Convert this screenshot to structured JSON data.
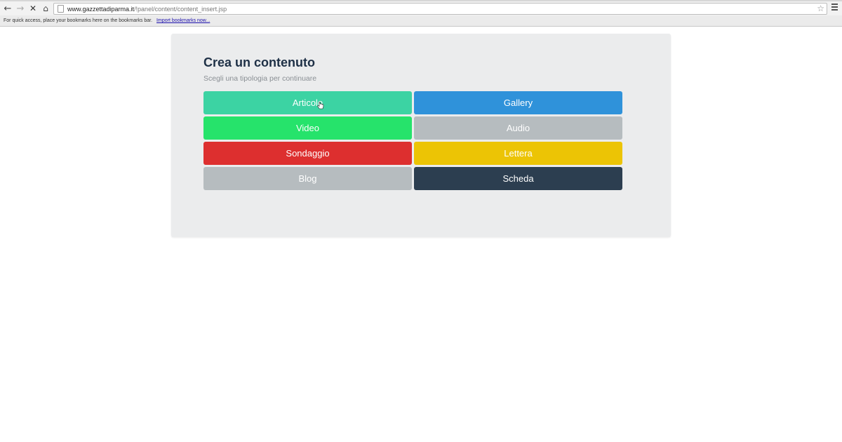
{
  "browser": {
    "url_host": "www.gazzettadiparma.it",
    "url_path": "/!panel/content/content_insert.jsp",
    "bookmarks_message": "For quick access, place your bookmarks here on the bookmarks bar.",
    "bookmarks_link": "Import bookmarks now...",
    "icons": {
      "back": "back-arrow-icon",
      "forward": "forward-arrow-icon",
      "stop": "stop-icon",
      "home": "home-icon",
      "bookmark": "star-icon",
      "menu": "menu-icon"
    }
  },
  "panel": {
    "title": "Crea un contenuto",
    "subtitle": "Scegli una tipologia per continuare",
    "background": "#ebeced"
  },
  "content_types": [
    {
      "label": "Articolo",
      "color": "#3cd3a3"
    },
    {
      "label": "Gallery",
      "color": "#2f92da"
    },
    {
      "label": "Video",
      "color": "#26e36b"
    },
    {
      "label": "Audio",
      "color": "#b6bcbf"
    },
    {
      "label": "Sondaggio",
      "color": "#dd2f2f"
    },
    {
      "label": "Lettera",
      "color": "#ecc405"
    },
    {
      "label": "Blog",
      "color": "#b6bcbf"
    },
    {
      "label": "Scheda",
      "color": "#2c3e50"
    }
  ]
}
